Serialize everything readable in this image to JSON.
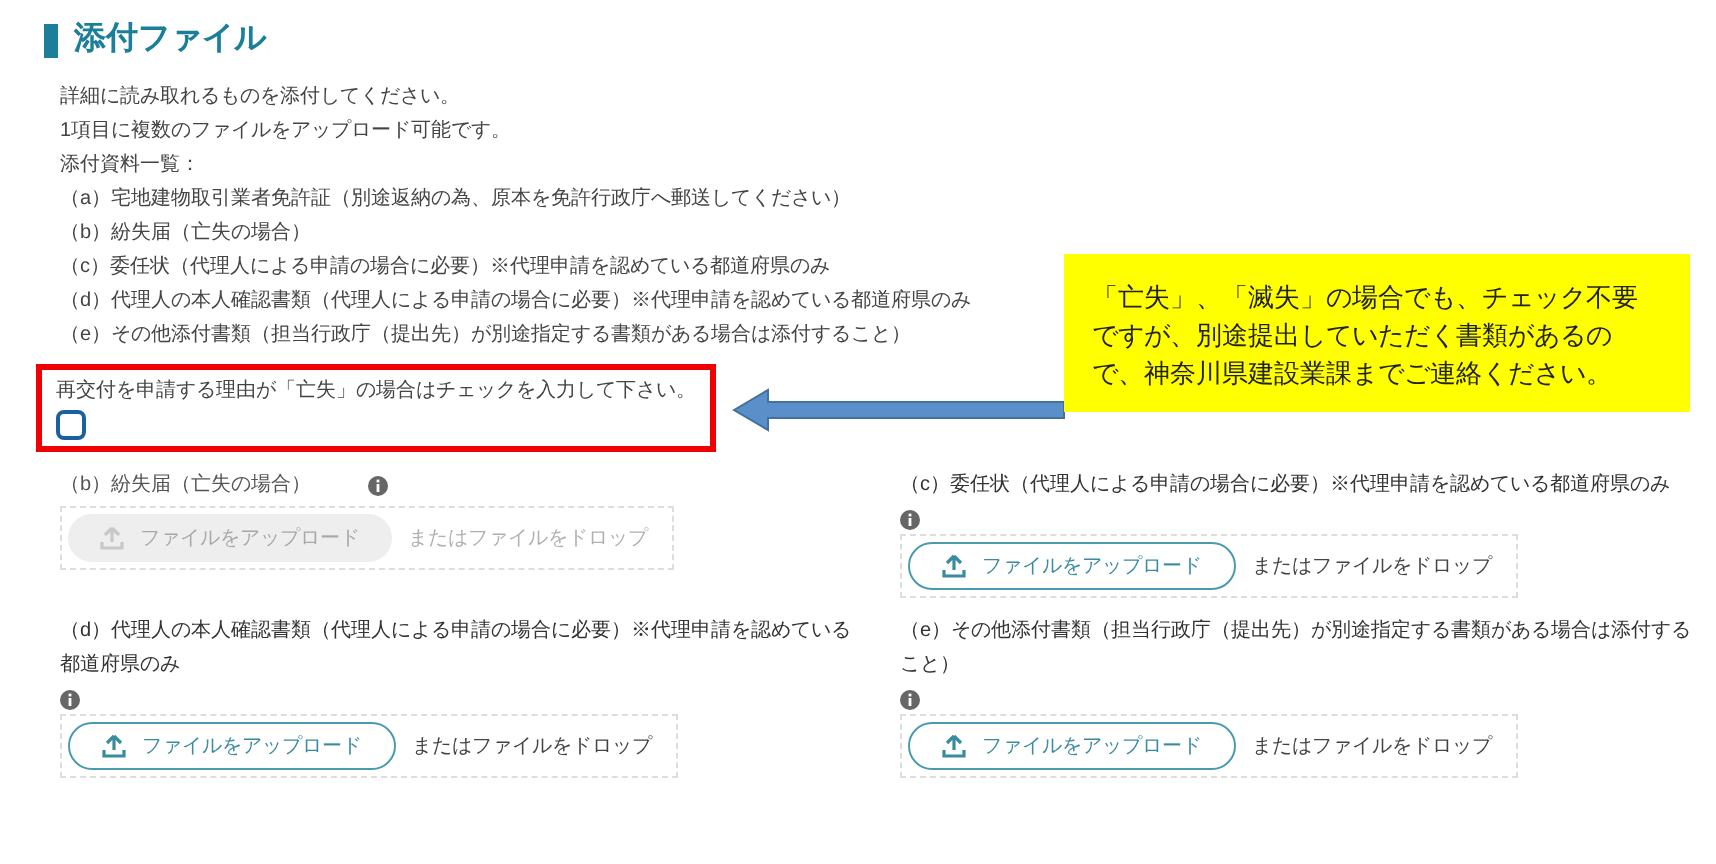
{
  "heading": "添付ファイル",
  "intro": [
    "詳細に読み取れるものを添付してください。",
    "1項目に複数のファイルをアップロード可能です。",
    "添付資料一覧："
  ],
  "list": [
    "（a）宅地建物取引業者免許証（別途返納の為、原本を免許行政庁へ郵送してください）",
    "（b）紛失届（亡失の場合）",
    "（c）委任状（代理人による申請の場合に必要）※代理申請を認めている都道府県のみ",
    "（d）代理人の本人確認書類（代理人による申請の場合に必要）※代理申請を認めている都道府県のみ",
    "（e）その他添付書類（担当行政庁（提出先）が別途指定する書類がある場合は添付すること）"
  ],
  "checkbox": {
    "label": "再交付を申請する理由が「亡失」の場合はチェックを入力して下さい。",
    "checked": false
  },
  "callout": "「亡失」、「滅失」の場合でも、チェック不要ですが、別途提出していただく書類があるので、神奈川県建設業課までご連絡ください。",
  "uploads": [
    {
      "label": "（b）紛失届（亡失の場合）",
      "disabled": true,
      "button": "ファイルをアップロード",
      "drop": "またはファイルをドロップ"
    },
    {
      "label": "（c）委任状（代理人による申請の場合に必要）※代理申請を認めている都道府県のみ",
      "disabled": false,
      "button": "ファイルをアップロード",
      "drop": "またはファイルをドロップ"
    },
    {
      "label": "（d）代理人の本人確認書類（代理人による申請の場合に必要）※代理申請を認めている都道府県のみ",
      "disabled": false,
      "button": "ファイルをアップロード",
      "drop": "またはファイルをドロップ"
    },
    {
      "label": "（e）その他添付書類（担当行政庁（提出先）が別途指定する書類がある場合は添付すること）",
      "disabled": false,
      "button": "ファイルをアップロード",
      "drop": "またはファイルをドロップ"
    }
  ]
}
